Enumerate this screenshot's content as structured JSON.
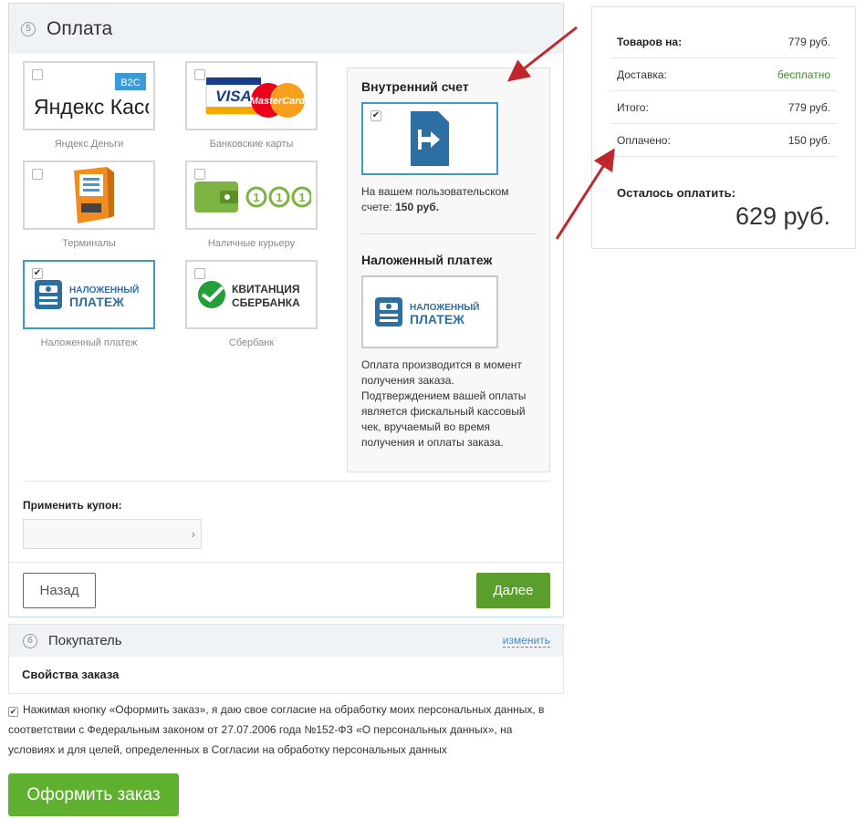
{
  "payment": {
    "step": "5",
    "title": "Оплата",
    "methods": [
      {
        "label": "Яндекс.Деньги",
        "logo_text": "Яндекс Касса",
        "logo_badge": "B2C",
        "checked": false
      },
      {
        "label": "Банковские карты",
        "logo_text_visa": "VISA",
        "logo_text_mc": "MasterCard",
        "checked": false
      },
      {
        "label": "Терминалы",
        "checked": false
      },
      {
        "label": "Наличные курьеру",
        "checked": false
      },
      {
        "label": "Наложенный платеж",
        "logo_line1": "НАЛОЖЕННЫЙ",
        "logo_line2": "ПЛАТЕЖ",
        "checked": true
      },
      {
        "label": "Сбербанк",
        "logo_line1": "КВИТАНЦИЯ",
        "logo_line2": "СБЕРБАНКА",
        "checked": false
      }
    ],
    "inner_account": {
      "title": "Внутренний счет",
      "checked": true,
      "text_prefix": "На вашем пользовательском счете: ",
      "balance": "150 руб."
    },
    "cod": {
      "title": "Наложенный платеж",
      "logo_line1": "НАЛОЖЕННЫЙ",
      "logo_line2": "ПЛАТЕЖ",
      "description": "Оплата производится в момент получения заказа. Подтверждением вашей оплаты является фискальный кассовый чек, вручаемый во время получения и оплаты заказа."
    },
    "coupon": {
      "label": "Применить купон:",
      "value": "",
      "go": "›"
    },
    "back_label": "Назад",
    "next_label": "Далее"
  },
  "buyer": {
    "step": "6",
    "title": "Покупатель",
    "edit_label": "изменить",
    "order_props": "Свойства заказа"
  },
  "consent": {
    "checked": true,
    "text": "Нажимая кнопку «Оформить заказ», я даю свое согласие на обработку моих персональных данных, в соответствии с Федеральным законом от 27.07.2006 года №152-ФЗ «О персональных данных», на условиях и для целей, определенных в Согласии на обработку персональных данных"
  },
  "order_button": "Оформить заказ",
  "summary": {
    "rows": [
      {
        "label": "Товаров на:",
        "value": "779 руб."
      },
      {
        "label": "Доставка:",
        "value": "бесплатно"
      },
      {
        "label": "Итого:",
        "value": "779 руб."
      },
      {
        "label": "Оплачено:",
        "value": "150 руб."
      }
    ],
    "remaining_label": "Осталось оплатить:",
    "remaining_value": "629 руб."
  },
  "colors": {
    "accent_blue": "#3a9bc0",
    "green_button": "#5fb02f",
    "arrow_red": "#c0272d"
  }
}
